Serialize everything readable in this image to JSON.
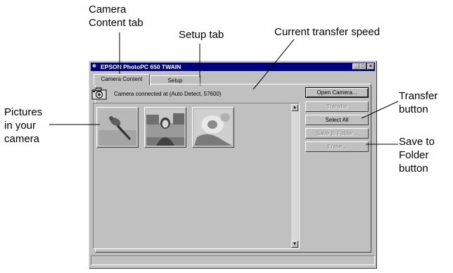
{
  "annotations": {
    "camera_content_tab_line1": "Camera",
    "camera_content_tab_line2": "Content tab",
    "setup_tab": "Setup tab",
    "current_transfer_speed": "Current transfer speed",
    "pictures_line1": "Pictures",
    "pictures_line2": "in your",
    "pictures_line3": "camera",
    "transfer_button_line1": "Transfer",
    "transfer_button_line2": "button",
    "save_button_line1": "Save to",
    "save_button_line2": "Folder",
    "save_button_line3": "button"
  },
  "window": {
    "title": "EPSON PhotoPC 650 TWAIN",
    "minimize_glyph": "_",
    "maximize_glyph": "□",
    "close_glyph": "×"
  },
  "tabs": [
    {
      "label": "Camera Content",
      "active": true
    },
    {
      "label": "Setup",
      "active": false
    }
  ],
  "status": {
    "connection_text": "Camera connected at (Auto Detect, 57600)"
  },
  "thumbnails": [
    {
      "name": "bird"
    },
    {
      "name": "person"
    },
    {
      "name": "flowers"
    }
  ],
  "buttons": {
    "open_camera": "Open Camera...",
    "transfer": "Transfer",
    "select_all": "Select All",
    "save_to_folder": "Save to Folder...",
    "erase": "Erase..."
  },
  "colors": {
    "titlebar": "#000080",
    "window_face": "#c0c0c0"
  }
}
